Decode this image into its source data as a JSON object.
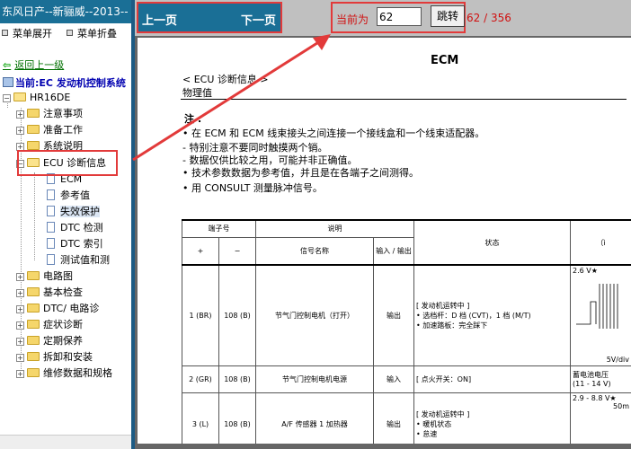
{
  "window_title": "东风日产--新骊威--2013--",
  "menu": {
    "expand": "菜单展开",
    "collapse": "菜单折叠"
  },
  "back_link": "返回上一级",
  "current_label": "当前:EC 发动机控制系统",
  "tree": {
    "root": "HR16DE",
    "items": [
      {
        "label": "注意事项"
      },
      {
        "label": "准备工作"
      },
      {
        "label": "系统说明"
      },
      {
        "label": "ECU 诊断信息",
        "children": [
          "ECM",
          "参考值",
          "失效保护",
          "DTC 检测",
          "DTC 索引",
          "测试值和测"
        ]
      },
      {
        "label": "电路图"
      },
      {
        "label": "基本检查"
      },
      {
        "label": "DTC/ 电路诊"
      },
      {
        "label": "症状诊断"
      },
      {
        "label": "定期保养"
      },
      {
        "label": "拆卸和安装"
      },
      {
        "label": "维修数据和规格"
      }
    ]
  },
  "nav": {
    "prev": "上一页",
    "next": "下一页",
    "current_label": "当前为",
    "page_value": "62",
    "jump": "跳转",
    "page_count": "62 / 356"
  },
  "doc": {
    "header": "ECM",
    "section": "< ECU 诊断信息 >",
    "subtitle": "物理值",
    "note_title": "注 :",
    "notes": [
      "• 在 ECM 和 ECM 线束接头之间连接一个接线盒和一个线束适配器。",
      "- 特别注意不要同时触摸两个销。",
      "- 数据仅供比较之用，可能并非正确值。",
      "• 技术参数数据为参考值，并且是在各端子之间测得。",
      "• 用 CONSULT 测量脉冲信号。"
    ],
    "table": {
      "h_terminal": "端子号",
      "h_desc": "说明",
      "h_plus": "+",
      "h_minus": "−",
      "h_signal": "信号名称",
      "h_io": "输入 / 输出",
      "h_state": "状态",
      "h_ref": "（ì",
      "rows": [
        {
          "plus": "1 (BR)",
          "minus": "108 (B)",
          "signal": "节气门控制电机（打开）",
          "io": "输出",
          "state": [
            "[ 发动机运转中 ]",
            "• 选档杆：D 档 (CVT)，1 档 (M/T)",
            "• 加速踏板：完全踩下"
          ],
          "ref": "2.6 V★",
          "ref2": "5V/div"
        },
        {
          "plus": "2 (GR)",
          "minus": "108 (B)",
          "signal": "节气门控制电机电源",
          "io": "输入",
          "state": [
            "[ 点火开关：ON]"
          ],
          "ref": "蓄电池电压",
          "ref2": "(11 - 14 V)"
        },
        {
          "plus": "3 (L)",
          "minus": "108 (B)",
          "signal": "A/F 传感器 1 加热器",
          "io": "输出",
          "state": [
            "[ 发动机运转中 ]",
            "• 暖机状态",
            "• 怠速"
          ],
          "ref": "2.9 - 8.8 V★",
          "ref2": "50m"
        }
      ]
    }
  }
}
